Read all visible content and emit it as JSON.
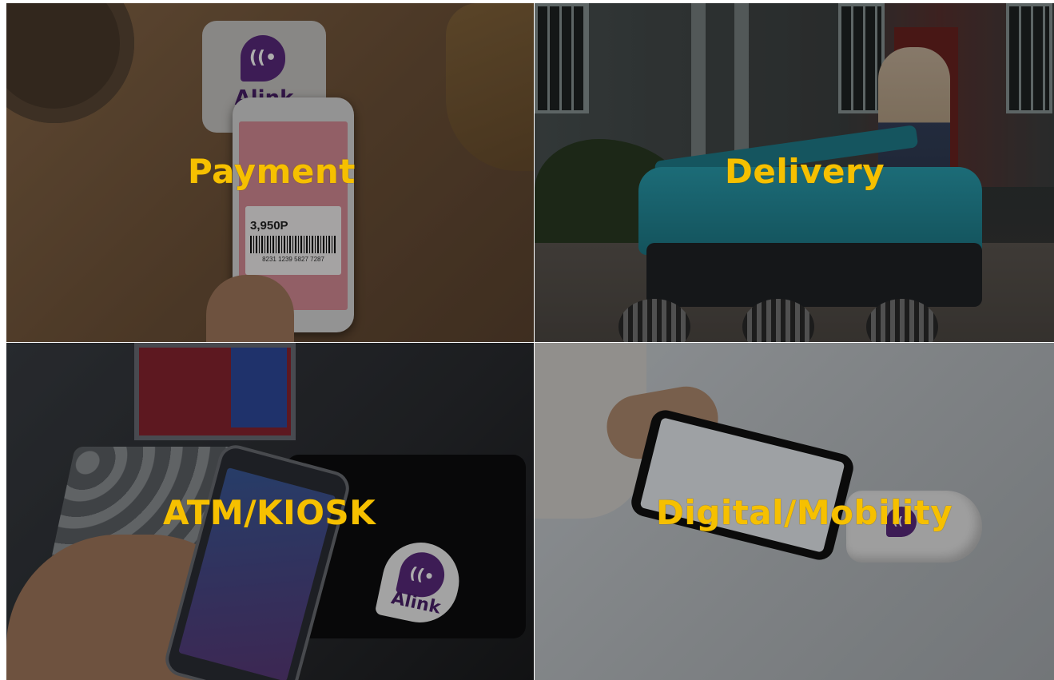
{
  "tiles": [
    {
      "label": "Payment",
      "tag_text": "Alink",
      "phone_points": "3,950P",
      "phone_barcode_number": "8231 1239 5827 7287"
    },
    {
      "label": "Delivery"
    },
    {
      "label": "ATM/KIOSK",
      "sticker_text": "Alink"
    },
    {
      "label": "Digital/Mobility"
    }
  ],
  "colors": {
    "caption": "#f6c000",
    "brand_purple": "#5a2a7e"
  },
  "icons": [
    "nfc-logo-icon",
    "barcode-icon"
  ]
}
